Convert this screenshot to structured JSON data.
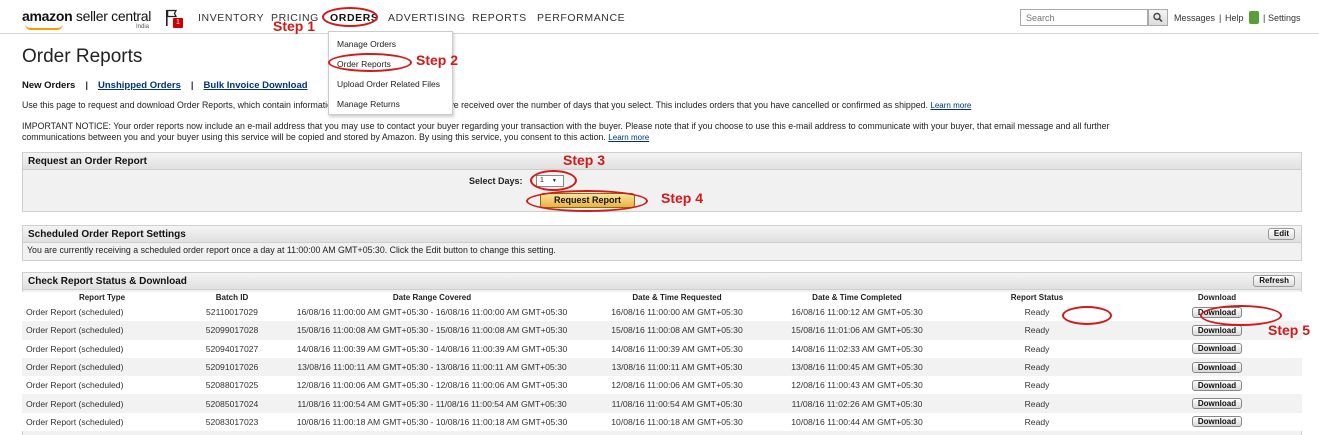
{
  "brand": {
    "name_bold": "amazon",
    "name_light": " seller central",
    "region": "India"
  },
  "nav": {
    "items": [
      "INVENTORY",
      "PRICING",
      "ORDERS",
      "ADVERTISING",
      "REPORTS",
      "PERFORMANCE"
    ]
  },
  "search": {
    "placeholder": "Search"
  },
  "top_links": {
    "messages": "Messages",
    "help": "Help",
    "settings": "Settings",
    "sep": "|"
  },
  "orders_menu": {
    "items": [
      "Manage Orders",
      "Order Reports",
      "Upload Order Related Files",
      "Manage Returns"
    ]
  },
  "page": {
    "title": "Order Reports",
    "subnav": {
      "active": "New Orders",
      "links": [
        "Unshipped Orders",
        "Bulk Invoice Download"
      ],
      "sep": "|"
    },
    "intro": "Use this page to request and download Order Reports, which contain information about the orders that you have received over the number of days that you select. This includes orders that you have cancelled or confirmed as shipped.",
    "learn_more": "Learn more",
    "notice_line1": "IMPORTANT NOTICE: Your order reports now include an e-mail address that you may use to contact your buyer regarding your transaction with the buyer. Please note that if you choose to use this e-mail address to communicate with your buyer, that email message and all further",
    "notice_line2": "communications between you and your buyer using this service will be copied and stored by Amazon. By using this service, you consent to this action."
  },
  "request_section": {
    "title": "Request an Order Report",
    "select_label": "Select Days:",
    "select_value": "1",
    "button": "Request Report"
  },
  "scheduled_section": {
    "title": "Scheduled Order Report Settings",
    "edit_button": "Edit",
    "message": "You are currently receiving a scheduled order report once a day at 11:00:00 AM GMT+05:30. Click the Edit button to change this setting."
  },
  "status_section": {
    "title": "Check Report Status & Download",
    "refresh_button": "Refresh",
    "columns": [
      "Report Type",
      "Batch ID",
      "Date Range Covered",
      "Date & Time Requested",
      "Date & Time Completed",
      "Report Status",
      "Download"
    ],
    "rows": [
      [
        "Order Report (scheduled)",
        "52110017029",
        "16/08/16 11:00:00 AM GMT+05:30 - 16/08/16 11:00:00 AM GMT+05:30",
        "16/08/16 11:00:00 AM GMT+05:30",
        "16/08/16 11:00:12 AM GMT+05:30",
        "Ready",
        "Download"
      ],
      [
        "Order Report (scheduled)",
        "52099017028",
        "15/08/16 11:00:08 AM GMT+05:30 - 15/08/16 11:00:08 AM GMT+05:30",
        "15/08/16 11:00:08 AM GMT+05:30",
        "15/08/16 11:01:06 AM GMT+05:30",
        "Ready",
        "Download"
      ],
      [
        "Order Report (scheduled)",
        "52094017027",
        "14/08/16 11:00:39 AM GMT+05:30 - 14/08/16 11:00:39 AM GMT+05:30",
        "14/08/16 11:00:39 AM GMT+05:30",
        "14/08/16 11:02:33 AM GMT+05:30",
        "Ready",
        "Download"
      ],
      [
        "Order Report (scheduled)",
        "52091017026",
        "13/08/16 11:00:11 AM GMT+05:30 - 13/08/16 11:00:11 AM GMT+05:30",
        "13/08/16 11:00:11 AM GMT+05:30",
        "13/08/16 11:00:45 AM GMT+05:30",
        "Ready",
        "Download"
      ],
      [
        "Order Report (scheduled)",
        "52088017025",
        "12/08/16 11:00:06 AM GMT+05:30 - 12/08/16 11:00:06 AM GMT+05:30",
        "12/08/16 11:00:06 AM GMT+05:30",
        "12/08/16 11:00:43 AM GMT+05:30",
        "Ready",
        "Download"
      ],
      [
        "Order Report (scheduled)",
        "52085017024",
        "11/08/16 11:00:54 AM GMT+05:30 - 11/08/16 11:00:54 AM GMT+05:30",
        "11/08/16 11:00:54 AM GMT+05:30",
        "11/08/16 11:02:26 AM GMT+05:30",
        "Ready",
        "Download"
      ],
      [
        "Order Report (scheduled)",
        "52083017023",
        "10/08/16 11:00:18 AM GMT+05:30 - 10/08/16 11:00:18 AM GMT+05:30",
        "10/08/16 11:00:18 AM GMT+05:30",
        "10/08/16 11:00:44 AM GMT+05:30",
        "Ready",
        "Download"
      ]
    ]
  },
  "annotations": {
    "steps": [
      "Step 1",
      "Step 2",
      "Step 3",
      "Step 4",
      "Step 5"
    ],
    "color": "#d31a1a"
  },
  "icons": {
    "flag": "flag-icon",
    "search": "search-icon",
    "help": "help-icon"
  }
}
